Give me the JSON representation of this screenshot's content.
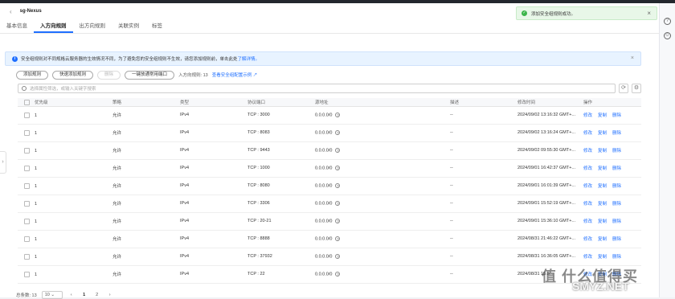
{
  "header": {
    "title": "sg-Nexus"
  },
  "tabs": [
    {
      "label": "基本信息"
    },
    {
      "label": "入方向规则"
    },
    {
      "label": "出方向规则"
    },
    {
      "label": "关联实例"
    },
    {
      "label": "标签"
    }
  ],
  "toast": {
    "text": "添加安全组规则成功。"
  },
  "info": {
    "text": "安全组规则对不同规格云服务器的生效情况不同，为了避免您的安全组规则不生效，请您添加规则前，单击此处",
    "link": "了解详情。"
  },
  "toolbar": {
    "add_rule": "添加规则",
    "quick_add": "快速添加规则",
    "delete": "删除",
    "one_click": "一键放通常用端口",
    "rule_count_label": "入方向规则: 13",
    "example_link": "查看安全组配置示例"
  },
  "search": {
    "placeholder": "选择属性筛选，或输入关键字搜索"
  },
  "table": {
    "headers": [
      "优先级",
      "策略",
      "类型",
      "协议端口",
      "源地址",
      "描述",
      "修改时间",
      "操作"
    ],
    "ops": [
      "修改",
      "复制",
      "删除"
    ],
    "rows": [
      {
        "priority": "1",
        "policy": "允许",
        "type": "IPv4",
        "port": "TCP : 3000",
        "source": "0.0.0.0/0",
        "desc": "--",
        "time": "2024/09/02 13:16:32 GMT+..."
      },
      {
        "priority": "1",
        "policy": "允许",
        "type": "IPv4",
        "port": "TCP : 8083",
        "source": "0.0.0.0/0",
        "desc": "--",
        "time": "2024/09/02 13:16:24 GMT+..."
      },
      {
        "priority": "1",
        "policy": "允许",
        "type": "IPv4",
        "port": "TCP : 9443",
        "source": "0.0.0.0/0",
        "desc": "--",
        "time": "2024/09/02 09:55:30 GMT+..."
      },
      {
        "priority": "1",
        "policy": "允许",
        "type": "IPv4",
        "port": "TCP : 1000",
        "source": "0.0.0.0/0",
        "desc": "--",
        "time": "2024/09/01 16:42:37 GMT+..."
      },
      {
        "priority": "1",
        "policy": "允许",
        "type": "IPv4",
        "port": "TCP : 8080",
        "source": "0.0.0.0/0",
        "desc": "--",
        "time": "2024/09/01 16:01:39 GMT+..."
      },
      {
        "priority": "1",
        "policy": "允许",
        "type": "IPv4",
        "port": "TCP : 3306",
        "source": "0.0.0.0/0",
        "desc": "--",
        "time": "2024/09/01 15:52:19 GMT+..."
      },
      {
        "priority": "1",
        "policy": "允许",
        "type": "IPv4",
        "port": "TCP : 20-21",
        "source": "0.0.0.0/0",
        "desc": "--",
        "time": "2024/09/01 15:36:10 GMT+..."
      },
      {
        "priority": "1",
        "policy": "允许",
        "type": "IPv4",
        "port": "TCP : 8888",
        "source": "0.0.0.0/0",
        "desc": "--",
        "time": "2024/08/31 21:46:22 GMT+..."
      },
      {
        "priority": "1",
        "policy": "允许",
        "type": "IPv4",
        "port": "TCP : 37932",
        "source": "0.0.0.0/0",
        "desc": "--",
        "time": "2024/08/31 16:36:05 GMT+..."
      },
      {
        "priority": "1",
        "policy": "允许",
        "type": "IPv4",
        "port": "TCP : 22",
        "source": "0.0.0.0/0",
        "desc": "--",
        "time": "2024/08/31 15:5..."
      }
    ]
  },
  "footer": {
    "total": "总条数: 13",
    "page_size": "10",
    "pages": [
      "1",
      "2"
    ]
  },
  "watermark": {
    "text": "值 什么值得买",
    "text2": "SMYZ.NET"
  },
  "colors": {
    "accent": "#1f6fff",
    "success": "#3bb54a",
    "info_bg": "#e8f3ff"
  }
}
